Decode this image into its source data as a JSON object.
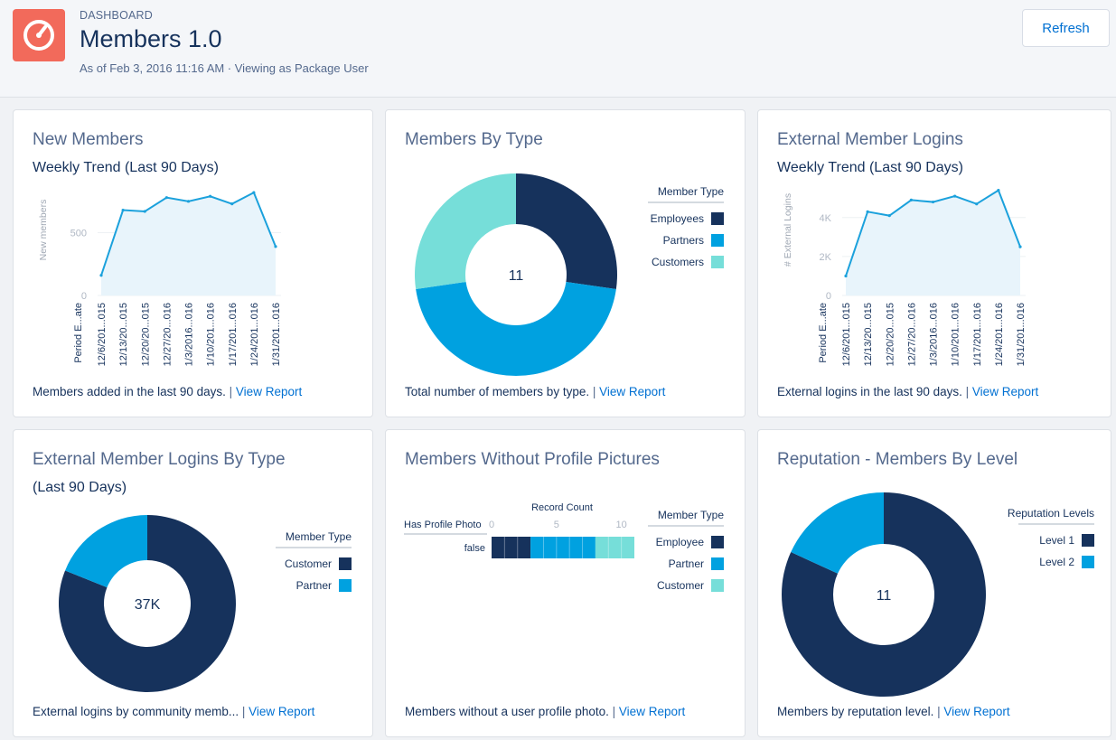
{
  "header": {
    "kicker": "DASHBOARD",
    "title": "Members 1.0",
    "as_of": "As of Feb 3, 2016 11:16 AM · Viewing as Package User",
    "refresh_label": "Refresh",
    "logo_icon": "gauge-icon",
    "logo_color": "#f26a5b"
  },
  "colors": {
    "dark": "#16325c",
    "blue": "#00a1e0",
    "teal": "#76ded9",
    "link": "#0070d2",
    "line": "#1ba1dc",
    "area": "#e8f4fb"
  },
  "cards": {
    "new_members": {
      "title": "New Members",
      "subtitle": "Weekly Trend (Last 90 Days)",
      "footer_text": "Members added in the last 90 days.",
      "footer_sep": "|",
      "footer_link": "View Report",
      "chart_data": {
        "type": "area",
        "ylabel": "New members",
        "xlabel": "Period E...ate",
        "x": [
          "12/6/201...015",
          "12/13/20...015",
          "12/20/20...015",
          "12/27/20...016",
          "1/3/2016...016",
          "1/10/201...016",
          "1/17/201...016",
          "1/24/201...016",
          "1/31/201...016"
        ],
        "values": [
          160,
          680,
          670,
          780,
          750,
          790,
          730,
          820,
          390
        ],
        "ylim": [
          0,
          900
        ],
        "yticks": [
          0,
          500
        ],
        "ytick_labels": [
          "0",
          "500"
        ]
      }
    },
    "members_by_type": {
      "title": "Members By Type",
      "footer_text": "Total number of members by type.",
      "footer_sep": "|",
      "footer_link": "View Report",
      "chart_data": {
        "type": "pie",
        "center_label": "11",
        "legend_title": "Member Type",
        "labels": [
          "Employees",
          "Partners",
          "Customers"
        ],
        "values": [
          3,
          5,
          3
        ],
        "colors": [
          "#16325c",
          "#00a1e0",
          "#76ded9"
        ]
      }
    },
    "external_logins": {
      "title": "External Member Logins",
      "subtitle": "Weekly Trend (Last 90 Days)",
      "footer_text": "External logins in the last 90 days.",
      "footer_sep": "|",
      "footer_link": "View Report",
      "chart_data": {
        "type": "area",
        "ylabel": "# External Logins",
        "xlabel": "Period E...ate",
        "x": [
          "12/6/201...015",
          "12/13/20...015",
          "12/20/20...015",
          "12/27/20...016",
          "1/3/2016...016",
          "1/10/201...016",
          "1/17/201...016",
          "1/24/201...016",
          "1/31/201...016"
        ],
        "values": [
          1000,
          4300,
          4100,
          4900,
          4800,
          5100,
          4700,
          5400,
          2500
        ],
        "ylim": [
          0,
          5800
        ],
        "yticks": [
          0,
          2000,
          4000
        ],
        "ytick_labels": [
          "0",
          "2K",
          "4K"
        ]
      }
    },
    "logins_by_type": {
      "title": "External Member Logins By Type",
      "subtitle": "(Last 90 Days)",
      "footer_text": "External logins by community memb...",
      "footer_sep": "|",
      "footer_link": "View Report",
      "chart_data": {
        "type": "pie",
        "center_label": "37K",
        "legend_title": "Member Type",
        "labels": [
          "Customer",
          "Partner"
        ],
        "values": [
          30000,
          7000
        ],
        "colors": [
          "#16325c",
          "#00a1e0"
        ]
      }
    },
    "no_photo": {
      "title": "Members Without Profile Pictures",
      "footer_text": "Members without a user profile photo.",
      "footer_sep": "|",
      "footer_link": "View Report",
      "chart_data": {
        "type": "bar",
        "orientation": "horizontal",
        "stacked": true,
        "axis_title": "Record Count",
        "category_header": "Has Profile Photo",
        "categories": [
          "false"
        ],
        "xticks": [
          0,
          5,
          10
        ],
        "xlim": [
          0,
          11
        ],
        "legend_title": "Member Type",
        "series": [
          {
            "name": "Employee",
            "values": [
              3
            ],
            "color": "#16325c"
          },
          {
            "name": "Partner",
            "values": [
              5
            ],
            "color": "#00a1e0"
          },
          {
            "name": "Customer",
            "values": [
              3
            ],
            "color": "#76ded9"
          }
        ]
      }
    },
    "reputation": {
      "title": "Reputation - Members By Level",
      "footer_text": "Members by reputation level.",
      "footer_sep": "|",
      "footer_link": "View Report",
      "chart_data": {
        "type": "pie",
        "center_label": "11",
        "legend_title": "Reputation Levels",
        "labels": [
          "Level 1",
          "Level 2"
        ],
        "values": [
          9,
          2
        ],
        "colors": [
          "#16325c",
          "#00a1e0"
        ]
      }
    }
  }
}
